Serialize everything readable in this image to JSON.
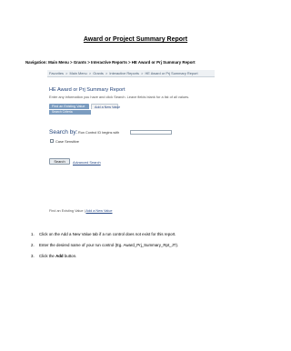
{
  "document": {
    "title": "Award or Project Summary Report",
    "navigation_label": "Navigation:",
    "navigation_path": "Main Menu > Grants > Interactive Reports > HE Award or Prj Summary Report"
  },
  "screenshot": {
    "breadcrumb": [
      "Favorites",
      "Main Menu",
      "Grants",
      "Interactive Reports",
      "HE Award or Prj Summary Report"
    ],
    "breadcrumb_separator": ">",
    "page_title": "HE Award or Prj Summary Report",
    "instruction": "Enter any information you have and click Search. Leave fields blank for a list of all values.",
    "tabs": [
      "Find an Existing Value",
      "Add a New Value"
    ],
    "section_header": "Search Criteria",
    "search_label": "Search by:",
    "search_field": "Run Control ID",
    "search_operator": "begins with",
    "case_sensitive_label": "Case Sensitive",
    "search_button": "Search",
    "advanced_search_link": "Advanced Search",
    "bottom_link_1": "Find an Existing Value",
    "bottom_separator": "|",
    "bottom_link_2": "Add a New Value"
  },
  "steps": [
    {
      "number": "1.",
      "text": "Click on the Add a New Value tab if a run control does not exist for this report."
    },
    {
      "number": "2.",
      "text": "Enter the desired name of your run control (Eg. Award_Prj_Summary_Rpt_JT)."
    },
    {
      "number": "3.",
      "text_before": "Click the ",
      "text_bold": "Add",
      "text_after": " button."
    }
  ]
}
